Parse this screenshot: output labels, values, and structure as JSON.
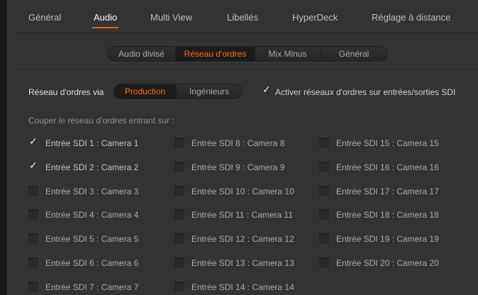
{
  "top_tabs": [
    {
      "label": "Général",
      "active": false
    },
    {
      "label": "Audio",
      "active": true
    },
    {
      "label": "Multi View",
      "active": false
    },
    {
      "label": "Libellés",
      "active": false
    },
    {
      "label": "HyperDeck",
      "active": false
    },
    {
      "label": "Réglage à distance",
      "active": false
    }
  ],
  "sub_tabs": [
    {
      "label": "Audio divisé",
      "active": false
    },
    {
      "label": "Réseau d'ordres",
      "active": true
    },
    {
      "label": "Mix Minus",
      "active": false
    },
    {
      "label": "Général",
      "active": false
    }
  ],
  "talkback": {
    "via_label": "Réseau d'ordres via",
    "via_options": [
      {
        "label": "Production",
        "active": true
      },
      {
        "label": "Ingénieurs",
        "active": false
      }
    ],
    "enable_sdi_label": "Activer réseaux d'ordres sur entrées/sorties SDI",
    "enable_sdi_checked": true,
    "mute_heading": "Couper le réseau d'ordres entrant sur :"
  },
  "inputs": [
    {
      "label": "Entrée SDI 1 : Camera 1",
      "checked": true
    },
    {
      "label": "Entrée SDI 2 : Camera 2",
      "checked": true
    },
    {
      "label": "Entrée SDI 3 : Camera 3",
      "checked": false
    },
    {
      "label": "Entrée SDI 4 : Camera 4",
      "checked": false
    },
    {
      "label": "Entrée SDI 5 : Camera 5",
      "checked": false
    },
    {
      "label": "Entrée SDI 6 : Camera 6",
      "checked": false
    },
    {
      "label": "Entrée SDI 7 : Camera 7",
      "checked": false
    },
    {
      "label": "Entrée SDI 8 : Camera 8",
      "checked": false
    },
    {
      "label": "Entrée SDI 9 : Camera 9",
      "checked": false
    },
    {
      "label": "Entrée SDI 10 : Camera 10",
      "checked": false
    },
    {
      "label": "Entrée SDI 11 : Camera 11",
      "checked": false
    },
    {
      "label": "Entrée SDI 12 : Camera 12",
      "checked": false
    },
    {
      "label": "Entrée SDI 13 : Camera 13",
      "checked": false
    },
    {
      "label": "Entrée SDI 14 : Camera 14",
      "checked": false
    },
    {
      "label": "Entrée SDI 15 : Camera 15",
      "checked": false
    },
    {
      "label": "Entrée SDI 16 : Camera 16",
      "checked": false
    },
    {
      "label": "Entrée SDI 17 : Camera 17",
      "checked": false
    },
    {
      "label": "Entrée SDI 18 : Camera 18",
      "checked": false
    },
    {
      "label": "Entrée SDI 19 : Camera 19",
      "checked": false
    },
    {
      "label": "Entrée SDI 20 : Camera 20",
      "checked": false
    }
  ],
  "colors": {
    "accent": "#e9620f",
    "background": "#333333"
  }
}
